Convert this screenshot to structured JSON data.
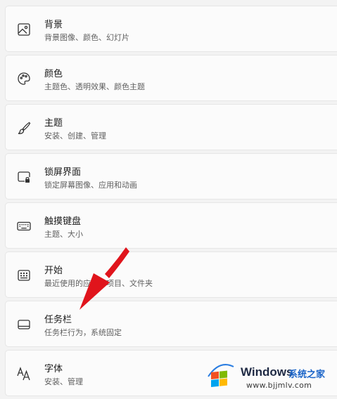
{
  "settings_items": [
    {
      "title": "背景",
      "subtitle": "背景图像、颜色、幻灯片",
      "icon": "image-icon"
    },
    {
      "title": "颜色",
      "subtitle": "主题色、透明效果、颜色主题",
      "icon": "palette-icon"
    },
    {
      "title": "主题",
      "subtitle": "安装、创建、管理",
      "icon": "brush-icon"
    },
    {
      "title": "锁屏界面",
      "subtitle": "锁定屏幕图像、应用和动画",
      "icon": "lock-screen-icon"
    },
    {
      "title": "触摸键盘",
      "subtitle": "主题、大小",
      "icon": "keyboard-icon"
    },
    {
      "title": "开始",
      "subtitle": "最近使用的应用和项目、文件夹",
      "icon": "start-icon"
    },
    {
      "title": "任务栏",
      "subtitle": "任务栏行为，系统固定",
      "icon": "taskbar-icon"
    },
    {
      "title": "字体",
      "subtitle": "安装、管理",
      "icon": "font-icon"
    }
  ],
  "annotation": {
    "color": "#e0141c"
  },
  "watermark": {
    "brand": "Windows",
    "site": "系统之家",
    "url": "www.bjjmlv.com",
    "logo_colors": [
      "#f25022",
      "#7fba00",
      "#00a4ef",
      "#ffb900"
    ]
  }
}
